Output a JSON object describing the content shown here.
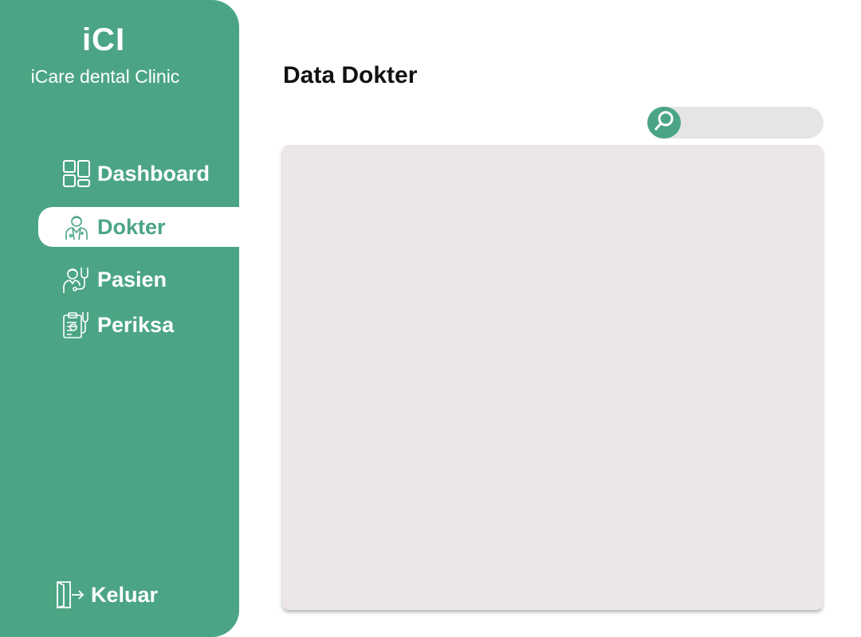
{
  "brand": {
    "logo": "iCI",
    "name": "iCare dental Clinic"
  },
  "sidebar": {
    "items": [
      {
        "label": "Dashboard",
        "icon": "dashboard-grid-icon",
        "active": false
      },
      {
        "label": "Dokter",
        "icon": "doctor-icon",
        "active": true
      },
      {
        "label": "Pasien",
        "icon": "patient-stethoscope-icon",
        "active": false
      },
      {
        "label": "Periksa",
        "icon": "clipboard-checkup-icon",
        "active": false
      }
    ],
    "logout": {
      "label": "Keluar",
      "icon": "logout-door-icon"
    }
  },
  "main": {
    "title": "Data Dokter",
    "search": {
      "placeholder": "",
      "value": "",
      "icon": "search-icon"
    }
  },
  "colors": {
    "primary": "#4ba584",
    "panel": "#ede6e6",
    "search_bg": "#e5e5e5"
  }
}
